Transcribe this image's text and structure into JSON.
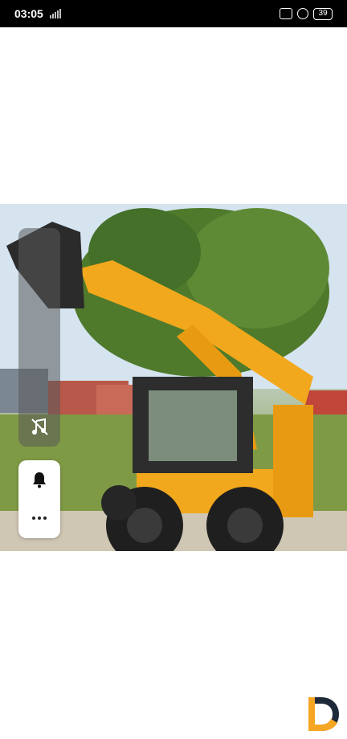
{
  "status_bar": {
    "time": "03:05",
    "battery": "39",
    "network_icon": "cellular-signal-icon",
    "icons": [
      "vibrate-icon",
      "alarm-icon",
      "battery-icon"
    ]
  },
  "photo": {
    "subject": "skid-steer-loader"
  },
  "side_controls": {
    "music_icon": "music-off-icon",
    "bell_icon": "bell-icon",
    "more_icon": "more-icon"
  },
  "colors": {
    "status_bar_bg": "#000000",
    "machine_yellow": "#f2a81c",
    "logo_orange": "#f5a623",
    "logo_dark": "#1e2a3a"
  }
}
